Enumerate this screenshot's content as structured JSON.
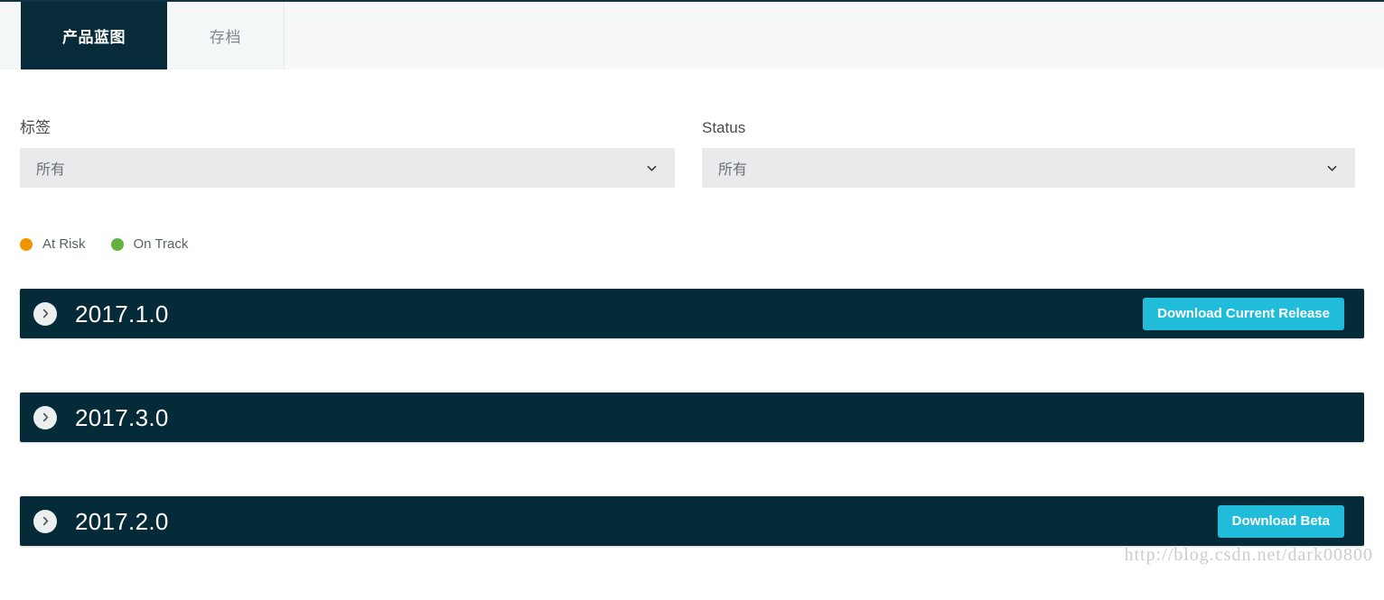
{
  "tabs": [
    {
      "label": "产品蓝图",
      "active": true
    },
    {
      "label": "存档",
      "active": false
    }
  ],
  "filters": {
    "tag": {
      "label": "标签",
      "value": "所有",
      "icon": "chevron-down-icon"
    },
    "status": {
      "label": "Status",
      "value": "所有",
      "icon": "chevron-down-icon"
    }
  },
  "legend": [
    {
      "label": "At Risk",
      "color": "#f29400"
    },
    {
      "label": "On Track",
      "color": "#67b141"
    }
  ],
  "releases": [
    {
      "version": "2017.1.0",
      "expand_icon": "chevron-right-icon",
      "button": "Download Current Release",
      "has_button": true
    },
    {
      "version": "2017.3.0",
      "expand_icon": "chevron-right-icon",
      "button": "",
      "has_button": false
    },
    {
      "version": "2017.2.0",
      "expand_icon": "chevron-right-icon",
      "button": "Download Beta",
      "has_button": true
    }
  ],
  "watermark": "http://blog.csdn.net/dark00800",
  "colors": {
    "row_background": "#062b38",
    "tab_active": "#072b38",
    "accent_cyan": "#22bcdb",
    "select_background": "#e9eaec"
  }
}
